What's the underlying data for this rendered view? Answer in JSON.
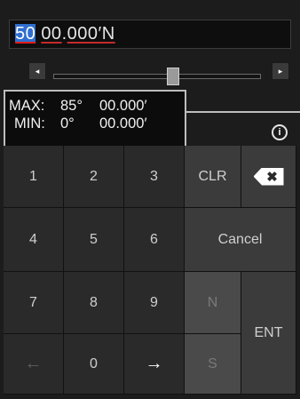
{
  "display": {
    "degrees": "50",
    "minutes_int": "00",
    "minutes_frac": "000",
    "suffix": "′N"
  },
  "slider": {
    "left_arrow": "◂",
    "right_arrow": "▸"
  },
  "range": {
    "max_label": "MAX:",
    "max_deg": "85°",
    "max_min": "00.000′",
    "min_label": "MIN:",
    "min_deg": "0°",
    "min_min": "00.000′"
  },
  "info_icon": "i",
  "keys": {
    "k1": "1",
    "k2": "2",
    "k3": "3",
    "k4": "4",
    "k5": "5",
    "k6": "6",
    "k7": "7",
    "k8": "8",
    "k9": "9",
    "k0": "0",
    "left_arrow": "←",
    "right_arrow": "→",
    "clr": "CLR",
    "backspace": "✖",
    "cancel": "Cancel",
    "n": "N",
    "s": "S",
    "ent": "ENT"
  }
}
